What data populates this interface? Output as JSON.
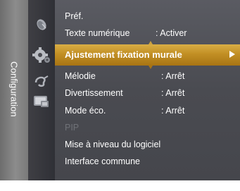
{
  "sidebar": {
    "label": "Configuration"
  },
  "menu": {
    "rows": [
      {
        "label": "Préf.",
        "value": ""
      },
      {
        "label": "Texte numérique",
        "value": ": Activer"
      },
      {
        "label": "Ajustement fixation murale",
        "value": ""
      },
      {
        "label": "Mélodie",
        "value": ": Arrêt"
      },
      {
        "label": "Divertissement",
        "value": ": Arrêt"
      },
      {
        "label": "Mode éco.",
        "value": ": Arrêt"
      },
      {
        "label": "PIP",
        "value": ""
      },
      {
        "label": "Mise à niveau du logiciel",
        "value": ""
      },
      {
        "label": "Interface commune",
        "value": ""
      }
    ],
    "selected_index": 2,
    "disabled_index": 6
  },
  "icons": [
    "satellite-dish-icon",
    "gear-icon",
    "ear-icon",
    "tv-screen-icon"
  ],
  "colors": {
    "highlight": "#c69428",
    "panel": "#4e4f55",
    "sidebar": "#7f7f7f",
    "disabled_text": "#707278"
  }
}
